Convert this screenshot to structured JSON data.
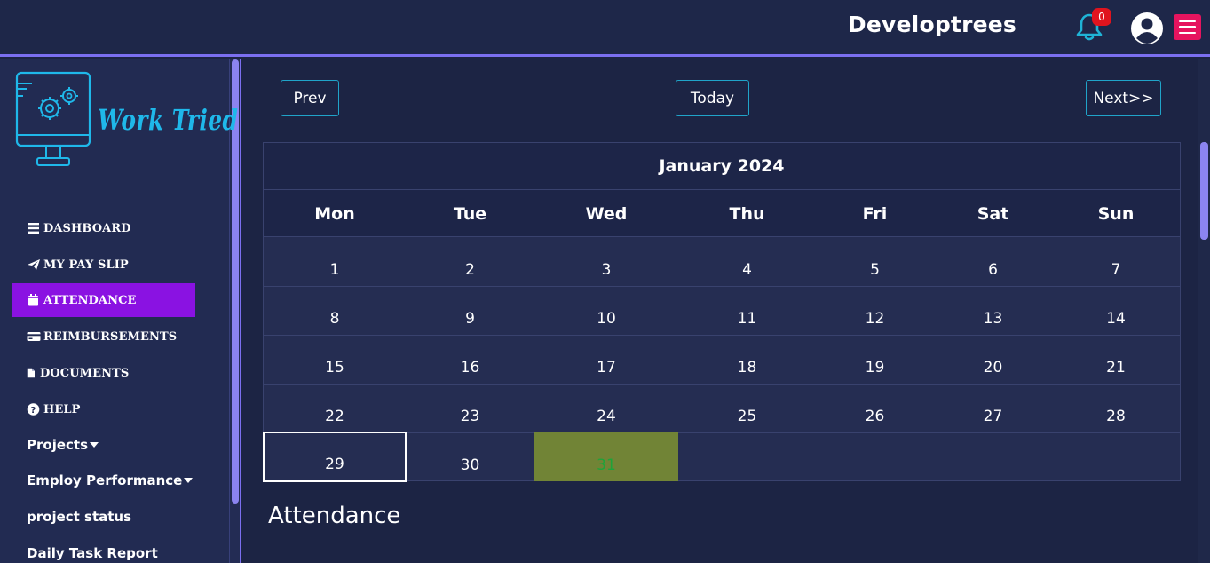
{
  "header": {
    "brand": "Developtrees",
    "notification_count": "0",
    "icons": {
      "bell": "bell-icon",
      "user": "user-circle-icon",
      "menu": "hamburger-menu-icon"
    },
    "colors": {
      "bell": "#1fb3d6",
      "badge": "#e0141e",
      "menu": "#e6145f",
      "accent_line": "#7b6ff0"
    }
  },
  "sidebar": {
    "logo_text": "Work Tried",
    "active_color": "#8a12e2",
    "items": [
      {
        "label": "DASHBOARD",
        "icon": "bars-icon"
      },
      {
        "label": "MY PAY SLIP",
        "icon": "paper-plane-icon"
      },
      {
        "label": "ATTENDANCE",
        "icon": "calendar-icon"
      },
      {
        "label": "REIMBURSEMENTS",
        "icon": "credit-card-icon"
      },
      {
        "label": "DOCUMENTS",
        "icon": "file-icon"
      },
      {
        "label": "HELP",
        "icon": "question-circle-icon"
      },
      {
        "label": "Projects",
        "icon": "caret-down-icon"
      },
      {
        "label": "Employ Performance",
        "icon": "caret-down-icon"
      },
      {
        "label": "project status"
      },
      {
        "label": "Daily Task Report"
      }
    ]
  },
  "calendar": {
    "prev_label": "Prev",
    "today_label": "Today",
    "next_label": "Next>>",
    "month_title": "January 2024",
    "weekdays": [
      "Mon",
      "Tue",
      "Wed",
      "Thu",
      "Fri",
      "Sat",
      "Sun"
    ],
    "weeks": [
      [
        "1",
        "2",
        "3",
        "4",
        "5",
        "6",
        "7"
      ],
      [
        "8",
        "9",
        "10",
        "11",
        "12",
        "13",
        "14"
      ],
      [
        "15",
        "16",
        "17",
        "18",
        "19",
        "20",
        "21"
      ],
      [
        "22",
        "23",
        "24",
        "25",
        "26",
        "27",
        "28"
      ],
      [
        "29",
        "30",
        "31",
        "",
        "",
        "",
        ""
      ]
    ],
    "selected_day": "29",
    "today_day": "31",
    "today_highlight_color": "#718436"
  },
  "main": {
    "section_title": "Attendance"
  }
}
